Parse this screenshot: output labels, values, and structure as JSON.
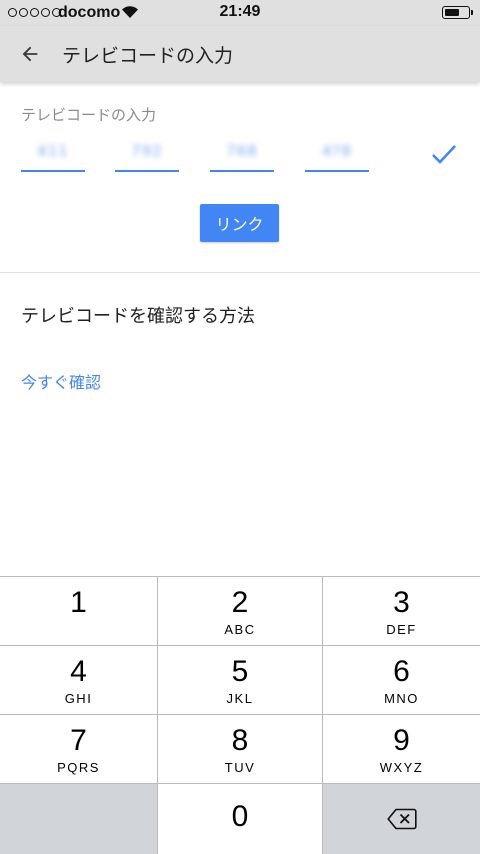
{
  "status_bar": {
    "carrier": "docomo",
    "time": "21:49",
    "signal_dots": 5,
    "battery_level": 0.65
  },
  "app_bar": {
    "title": "テレビコードの入力",
    "back_icon": "arrow-back-icon"
  },
  "form": {
    "label": "テレビコードの入力",
    "code_fields": [
      "411",
      "792",
      "768",
      "4?8"
    ],
    "confirm_icon": "checkmark-icon",
    "link_button_label": "リンク"
  },
  "help": {
    "heading": "テレビコードを確認する方法",
    "link_text": "今すぐ確認"
  },
  "keypad": {
    "keys": [
      {
        "num": "1",
        "letters": ""
      },
      {
        "num": "2",
        "letters": "ABC"
      },
      {
        "num": "3",
        "letters": "DEF"
      },
      {
        "num": "4",
        "letters": "GHI"
      },
      {
        "num": "5",
        "letters": "JKL"
      },
      {
        "num": "6",
        "letters": "MNO"
      },
      {
        "num": "7",
        "letters": "PQRS"
      },
      {
        "num": "8",
        "letters": "TUV"
      },
      {
        "num": "9",
        "letters": "WXYZ"
      },
      {
        "num": "0",
        "letters": ""
      }
    ],
    "delete_icon": "backspace-icon"
  },
  "colors": {
    "accent": "#4285f4",
    "app_bar": "#e0e0e0",
    "keypad_gray": "#d1d4d9"
  }
}
